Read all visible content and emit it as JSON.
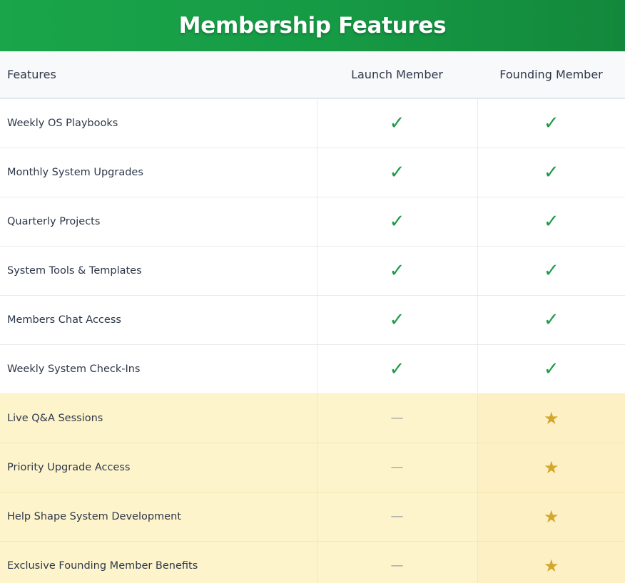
{
  "title": "Membership Features",
  "header": {
    "features": "Features",
    "launch": "Launch Member",
    "founding": "Founding Member"
  },
  "symbols": {
    "check": "✓",
    "dash": "—",
    "star": "★"
  },
  "colors": {
    "brand_green": "#1aa54a",
    "check_green": "#1d9a45",
    "star_gold": "#d4a72c",
    "premium_row_bg": "#fef4cc"
  },
  "rows": [
    {
      "label": "Weekly OS Playbooks",
      "launch": "check",
      "founding": "check"
    },
    {
      "label": "Monthly System Upgrades",
      "launch": "check",
      "founding": "check"
    },
    {
      "label": "Quarterly Projects",
      "launch": "check",
      "founding": "check"
    },
    {
      "label": "System Tools & Templates",
      "launch": "check",
      "founding": "check"
    },
    {
      "label": "Members Chat Access",
      "launch": "check",
      "founding": "check"
    },
    {
      "label": "Weekly System Check-Ins",
      "launch": "check",
      "founding": "check"
    },
    {
      "label": "Live Q&A Sessions",
      "launch": "dash",
      "founding": "star"
    },
    {
      "label": "Priority Upgrade Access",
      "launch": "dash",
      "founding": "star"
    },
    {
      "label": "Help Shape System Development",
      "launch": "dash",
      "founding": "star"
    },
    {
      "label": "Exclusive Founding Member Benefits",
      "launch": "dash",
      "founding": "star"
    }
  ]
}
